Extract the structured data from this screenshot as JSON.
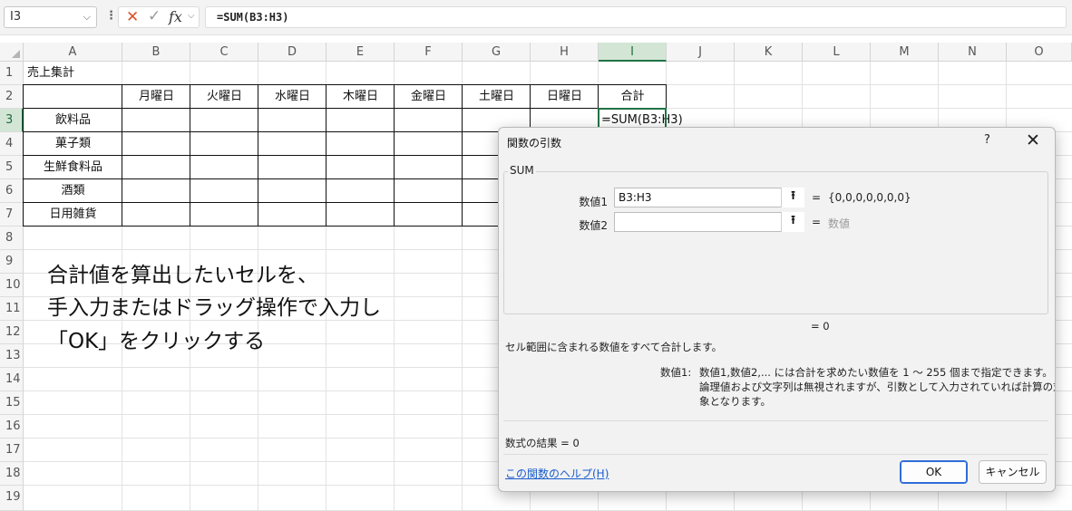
{
  "formula_bar": {
    "name_box": "I3",
    "chevron": "⌵",
    "more": "⋮",
    "cancel_icon": "✕",
    "enter_icon": "✓",
    "fx_label": "fx",
    "fx_chevron": "⌵",
    "formula": "=SUM(B3:H3)"
  },
  "columns": [
    "A",
    "B",
    "C",
    "D",
    "E",
    "F",
    "G",
    "H",
    "I",
    "J",
    "K",
    "L",
    "M",
    "N",
    "O"
  ],
  "rows": [
    "1",
    "2",
    "3",
    "4",
    "5",
    "6",
    "7",
    "8",
    "9",
    "10",
    "11",
    "12",
    "13",
    "14",
    "15",
    "16",
    "17",
    "18",
    "19"
  ],
  "sheet": {
    "A1": "売上集計",
    "headers": [
      "月曜日",
      "火曜日",
      "水曜日",
      "木曜日",
      "金曜日",
      "土曜日",
      "日曜日",
      "合計"
    ],
    "categories": [
      "飲料品",
      "菓子類",
      "生鮮食料品",
      "酒類",
      "日用雑貨"
    ],
    "I3": "=SUM(B3:H3)"
  },
  "instruction": [
    "合計値を算出したいセルを、",
    "手入力またはドラッグ操作で入力し",
    "「OK」をクリックする"
  ],
  "dialog": {
    "title": "関数の引数",
    "help": "?",
    "close": "✕",
    "function_name": "SUM",
    "arg1_label": "数値1",
    "arg1_value": "B3:H3",
    "arg1_result": "{0,0,0,0,0,0,0}",
    "arg2_label": "数値2",
    "arg2_value": "",
    "arg2_result": "数値",
    "collapse_icon": "⭱",
    "equals": "=",
    "total_result": "= 0",
    "description": "セル範囲に含まれる数値をすべて合計します。",
    "arg_help_label": "数値1:",
    "arg_help_line1": "数値1,数値2,... には合計を求めたい数値を 1 ～ 255 個まで指定できます。",
    "arg_help_line2": "論理値および文字列は無視されますが、引数として入力されていれば計算の対",
    "arg_help_line3": "象となります。",
    "formula_result": "数式の結果 =   0",
    "help_link": "この関数のヘルプ(H)",
    "ok_button": "OK",
    "cancel_button": "キャンセル"
  }
}
